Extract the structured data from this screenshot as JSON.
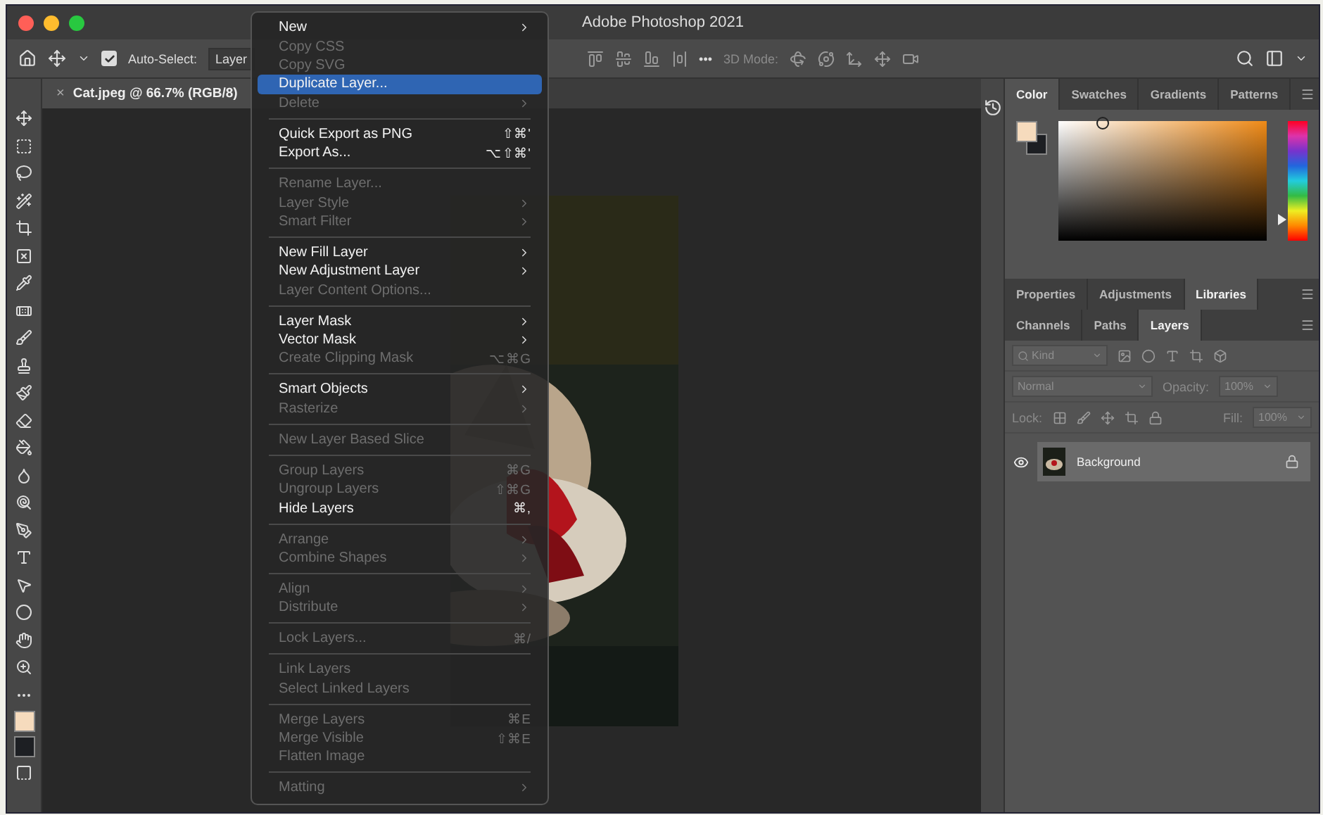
{
  "window": {
    "title": "Adobe Photoshop 2021"
  },
  "options_bar": {
    "auto_select": {
      "label": "Auto-Select:",
      "checked": true
    },
    "target": "Layer",
    "more": "•••",
    "mode_label": "3D Mode:"
  },
  "document_tab": {
    "title": "Cat.jpeg @ 66.7% (RGB/8)",
    "close": "×"
  },
  "menu": [
    {
      "kind": "item",
      "label": "New",
      "submenu": true,
      "disabled": false,
      "selected": false
    },
    {
      "kind": "item",
      "label": "Copy CSS",
      "disabled": true,
      "selected": false
    },
    {
      "kind": "item",
      "label": "Copy SVG",
      "disabled": true,
      "selected": false
    },
    {
      "kind": "item",
      "label": "Duplicate Layer...",
      "disabled": false,
      "selected": true
    },
    {
      "kind": "item",
      "label": "Delete",
      "submenu": true,
      "disabled": true,
      "selected": false
    },
    {
      "kind": "separator"
    },
    {
      "kind": "item",
      "label": "Quick Export as PNG",
      "shortcut": "⇧⌘'",
      "disabled": false,
      "selected": false
    },
    {
      "kind": "item",
      "label": "Export As...",
      "shortcut": "⌥⇧⌘'",
      "disabled": false,
      "selected": false
    },
    {
      "kind": "separator"
    },
    {
      "kind": "item",
      "label": "Rename Layer...",
      "disabled": true,
      "selected": false
    },
    {
      "kind": "item",
      "label": "Layer Style",
      "submenu": true,
      "disabled": true,
      "selected": false
    },
    {
      "kind": "item",
      "label": "Smart Filter",
      "submenu": true,
      "disabled": true,
      "selected": false
    },
    {
      "kind": "separator"
    },
    {
      "kind": "item",
      "label": "New Fill Layer",
      "submenu": true,
      "disabled": false,
      "selected": false
    },
    {
      "kind": "item",
      "label": "New Adjustment Layer",
      "submenu": true,
      "disabled": false,
      "selected": false
    },
    {
      "kind": "item",
      "label": "Layer Content Options...",
      "disabled": true,
      "selected": false
    },
    {
      "kind": "separator"
    },
    {
      "kind": "item",
      "label": "Layer Mask",
      "submenu": true,
      "disabled": false,
      "selected": false
    },
    {
      "kind": "item",
      "label": "Vector Mask",
      "submenu": true,
      "disabled": false,
      "selected": false
    },
    {
      "kind": "item",
      "label": "Create Clipping Mask",
      "shortcut": "⌥⌘G",
      "disabled": true,
      "selected": false
    },
    {
      "kind": "separator"
    },
    {
      "kind": "item",
      "label": "Smart Objects",
      "submenu": true,
      "disabled": false,
      "selected": false
    },
    {
      "kind": "item",
      "label": "Rasterize",
      "submenu": true,
      "disabled": true,
      "selected": false
    },
    {
      "kind": "separator"
    },
    {
      "kind": "item",
      "label": "New Layer Based Slice",
      "disabled": true,
      "selected": false
    },
    {
      "kind": "separator"
    },
    {
      "kind": "item",
      "label": "Group Layers",
      "shortcut": "⌘G",
      "disabled": true,
      "selected": false
    },
    {
      "kind": "item",
      "label": "Ungroup Layers",
      "shortcut": "⇧⌘G",
      "disabled": true,
      "selected": false
    },
    {
      "kind": "item",
      "label": "Hide Layers",
      "shortcut": "⌘,",
      "disabled": false,
      "selected": false
    },
    {
      "kind": "separator"
    },
    {
      "kind": "item",
      "label": "Arrange",
      "submenu": true,
      "disabled": true,
      "selected": false
    },
    {
      "kind": "item",
      "label": "Combine Shapes",
      "submenu": true,
      "disabled": true,
      "selected": false
    },
    {
      "kind": "separator"
    },
    {
      "kind": "item",
      "label": "Align",
      "submenu": true,
      "disabled": true,
      "selected": false
    },
    {
      "kind": "item",
      "label": "Distribute",
      "submenu": true,
      "disabled": true,
      "selected": false
    },
    {
      "kind": "separator"
    },
    {
      "kind": "item",
      "label": "Lock Layers...",
      "shortcut": "⌘/",
      "disabled": true,
      "selected": false
    },
    {
      "kind": "separator"
    },
    {
      "kind": "item",
      "label": "Link Layers",
      "disabled": true,
      "selected": false
    },
    {
      "kind": "item",
      "label": "Select Linked Layers",
      "disabled": true,
      "selected": false
    },
    {
      "kind": "separator"
    },
    {
      "kind": "item",
      "label": "Merge Layers",
      "shortcut": "⌘E",
      "disabled": true,
      "selected": false
    },
    {
      "kind": "item",
      "label": "Merge Visible",
      "shortcut": "⇧⌘E",
      "disabled": true,
      "selected": false
    },
    {
      "kind": "item",
      "label": "Flatten Image",
      "disabled": true,
      "selected": false
    },
    {
      "kind": "separator"
    },
    {
      "kind": "item",
      "label": "Matting",
      "submenu": true,
      "disabled": true,
      "selected": false
    }
  ],
  "color_panel": {
    "hue": {
      "level": 0.18
    }
  },
  "color_tabs": [
    {
      "label": "Color",
      "selected": true
    },
    {
      "label": "Swatches",
      "selected": false
    },
    {
      "label": "Gradients",
      "selected": false
    },
    {
      "label": "Patterns",
      "selected": false
    }
  ],
  "properties_tabs": [
    {
      "label": "Properties",
      "selected": false
    },
    {
      "label": "Adjustments",
      "selected": false
    },
    {
      "label": "Libraries",
      "selected": true
    }
  ],
  "layers_tabs": [
    {
      "label": "Channels",
      "selected": false
    },
    {
      "label": "Paths",
      "selected": false
    },
    {
      "label": "Layers",
      "selected": true
    }
  ],
  "layers_panel": {
    "filter_placeholder": "Kind",
    "blend_mode": "Normal",
    "opacity_label": "Opacity:",
    "opacity": "100%",
    "lock_label": "Lock:",
    "fill_label": "Fill:",
    "fill": "100%",
    "layers": [
      {
        "name": "Background",
        "visible": true,
        "locked": true,
        "selected": true
      }
    ]
  }
}
